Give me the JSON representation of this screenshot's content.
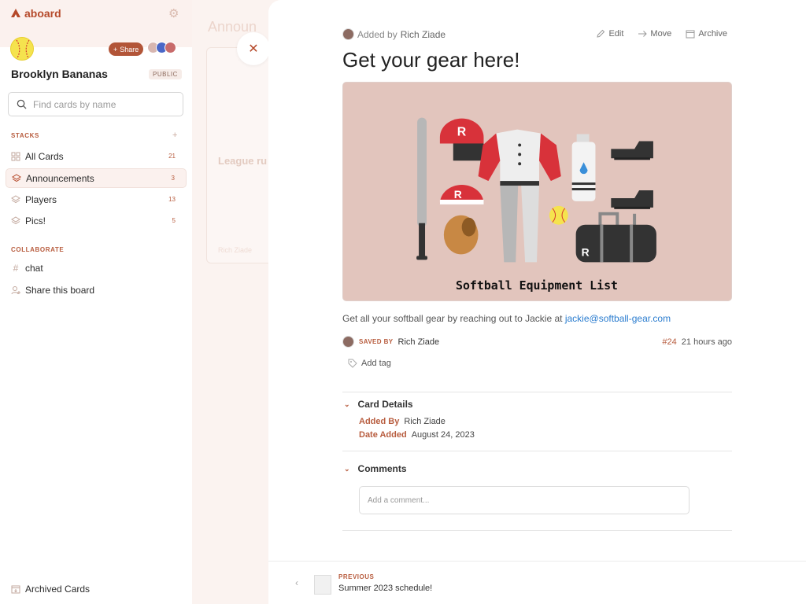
{
  "app": {
    "logo_text": "aboard"
  },
  "board": {
    "name": "Brooklyn Bananas",
    "visibility": "PUBLIC",
    "share_label": "Share"
  },
  "search": {
    "placeholder": "Find cards by name"
  },
  "stacks": {
    "label": "STACKS",
    "add_symbol": "+",
    "items": [
      {
        "label": "All Cards",
        "count": "21"
      },
      {
        "label": "Announcements",
        "count": "3"
      },
      {
        "label": "Players",
        "count": "13"
      },
      {
        "label": "Pics!",
        "count": "5"
      }
    ]
  },
  "collaborate": {
    "label": "COLLABORATE",
    "items": [
      {
        "label": "chat"
      },
      {
        "label": "Share this board"
      }
    ]
  },
  "archived": {
    "label": "Archived Cards"
  },
  "background": {
    "stack_title": "Announ",
    "card_title": "League ru",
    "card_author": "Rich Ziade"
  },
  "card": {
    "added_by_prefix": "Added by",
    "added_by_name": "Rich Ziade",
    "actions": {
      "edit": "Edit",
      "move": "Move",
      "archive": "Archive"
    },
    "title": "Get your gear here!",
    "image_caption": "Softball Equipment List",
    "description_text": "Get all your softball gear by reaching out to Jackie at",
    "description_email": "jackie@softball-gear.com",
    "saved_by_label": "SAVED BY",
    "saved_by_name": "Rich Ziade",
    "number": "#24",
    "time_ago": "21 hours ago",
    "add_tag": "Add tag"
  },
  "details": {
    "heading": "Card Details",
    "added_by_key": "Added By",
    "added_by_value": "Rich Ziade",
    "date_key": "Date Added",
    "date_value": "August 24, 2023"
  },
  "comments": {
    "heading": "Comments",
    "placeholder": "Add a comment..."
  },
  "footer": {
    "prev_label": "PREVIOUS",
    "prev_title": "Summer 2023 schedule!"
  },
  "colors": {
    "brand": "#b5492a",
    "accent": "#b85d3f",
    "link": "#2a7ccf",
    "hero_bg": "#e2c5bd"
  }
}
